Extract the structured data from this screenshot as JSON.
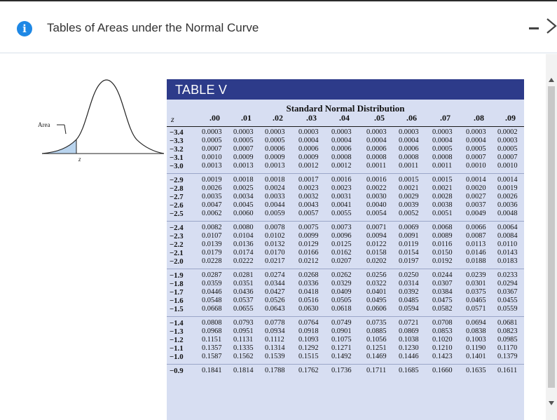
{
  "window": {
    "title": "Tables of Areas under the Normal Curve",
    "icons": {
      "info": "info-icon",
      "minimize": "minimize-icon",
      "close": "close-icon"
    }
  },
  "figure": {
    "area_label": "Area",
    "z_axis_label": "z"
  },
  "table": {
    "heading": "TABLE V",
    "subtitle": "Standard Normal Distribution",
    "z_header": "z",
    "columns": [
      ".00",
      ".01",
      ".02",
      ".03",
      ".04",
      ".05",
      ".06",
      ".07",
      ".08",
      ".09"
    ],
    "groups": [
      [
        {
          "z": "−3.4",
          "values": [
            "0.0003",
            "0.0003",
            "0.0003",
            "0.0003",
            "0.0003",
            "0.0003",
            "0.0003",
            "0.0003",
            "0.0003",
            "0.0002"
          ]
        },
        {
          "z": "−3.3",
          "values": [
            "0.0005",
            "0.0005",
            "0.0005",
            "0.0004",
            "0.0004",
            "0.0004",
            "0.0004",
            "0.0004",
            "0.0004",
            "0.0003"
          ]
        },
        {
          "z": "−3.2",
          "values": [
            "0.0007",
            "0.0007",
            "0.0006",
            "0.0006",
            "0.0006",
            "0.0006",
            "0.0006",
            "0.0005",
            "0.0005",
            "0.0005"
          ]
        },
        {
          "z": "−3.1",
          "values": [
            "0.0010",
            "0.0009",
            "0.0009",
            "0.0009",
            "0.0008",
            "0.0008",
            "0.0008",
            "0.0008",
            "0.0007",
            "0.0007"
          ]
        },
        {
          "z": "−3.0",
          "values": [
            "0.0013",
            "0.0013",
            "0.0013",
            "0.0012",
            "0.0012",
            "0.0011",
            "0.0011",
            "0.0011",
            "0.0010",
            "0.0010"
          ]
        }
      ],
      [
        {
          "z": "−2.9",
          "values": [
            "0.0019",
            "0.0018",
            "0.0018",
            "0.0017",
            "0.0016",
            "0.0016",
            "0.0015",
            "0.0015",
            "0.0014",
            "0.0014"
          ]
        },
        {
          "z": "−2.8",
          "values": [
            "0.0026",
            "0.0025",
            "0.0024",
            "0.0023",
            "0.0023",
            "0.0022",
            "0.0021",
            "0.0021",
            "0.0020",
            "0.0019"
          ]
        },
        {
          "z": "−2.7",
          "values": [
            "0.0035",
            "0.0034",
            "0.0033",
            "0.0032",
            "0.0031",
            "0.0030",
            "0.0029",
            "0.0028",
            "0.0027",
            "0.0026"
          ]
        },
        {
          "z": "−2.6",
          "values": [
            "0.0047",
            "0.0045",
            "0.0044",
            "0.0043",
            "0.0041",
            "0.0040",
            "0.0039",
            "0.0038",
            "0.0037",
            "0.0036"
          ]
        },
        {
          "z": "−2.5",
          "values": [
            "0.0062",
            "0.0060",
            "0.0059",
            "0.0057",
            "0.0055",
            "0.0054",
            "0.0052",
            "0.0051",
            "0.0049",
            "0.0048"
          ]
        }
      ],
      [
        {
          "z": "−2.4",
          "values": [
            "0.0082",
            "0.0080",
            "0.0078",
            "0.0075",
            "0.0073",
            "0.0071",
            "0.0069",
            "0.0068",
            "0.0066",
            "0.0064"
          ]
        },
        {
          "z": "−2.3",
          "values": [
            "0.0107",
            "0.0104",
            "0.0102",
            "0.0099",
            "0.0096",
            "0.0094",
            "0.0091",
            "0.0089",
            "0.0087",
            "0.0084"
          ]
        },
        {
          "z": "−2.2",
          "values": [
            "0.0139",
            "0.0136",
            "0.0132",
            "0.0129",
            "0.0125",
            "0.0122",
            "0.0119",
            "0.0116",
            "0.0113",
            "0.0110"
          ]
        },
        {
          "z": "−2.1",
          "values": [
            "0.0179",
            "0.0174",
            "0.0170",
            "0.0166",
            "0.0162",
            "0.0158",
            "0.0154",
            "0.0150",
            "0.0146",
            "0.0143"
          ]
        },
        {
          "z": "−2.0",
          "values": [
            "0.0228",
            "0.0222",
            "0.0217",
            "0.0212",
            "0.0207",
            "0.0202",
            "0.0197",
            "0.0192",
            "0.0188",
            "0.0183"
          ]
        }
      ],
      [
        {
          "z": "−1.9",
          "values": [
            "0.0287",
            "0.0281",
            "0.0274",
            "0.0268",
            "0.0262",
            "0.0256",
            "0.0250",
            "0.0244",
            "0.0239",
            "0.0233"
          ]
        },
        {
          "z": "−1.8",
          "values": [
            "0.0359",
            "0.0351",
            "0.0344",
            "0.0336",
            "0.0329",
            "0.0322",
            "0.0314",
            "0.0307",
            "0.0301",
            "0.0294"
          ]
        },
        {
          "z": "−1.7",
          "values": [
            "0.0446",
            "0.0436",
            "0.0427",
            "0.0418",
            "0.0409",
            "0.0401",
            "0.0392",
            "0.0384",
            "0.0375",
            "0.0367"
          ]
        },
        {
          "z": "−1.6",
          "values": [
            "0.0548",
            "0.0537",
            "0.0526",
            "0.0516",
            "0.0505",
            "0.0495",
            "0.0485",
            "0.0475",
            "0.0465",
            "0.0455"
          ]
        },
        {
          "z": "−1.5",
          "values": [
            "0.0668",
            "0.0655",
            "0.0643",
            "0.0630",
            "0.0618",
            "0.0606",
            "0.0594",
            "0.0582",
            "0.0571",
            "0.0559"
          ]
        }
      ],
      [
        {
          "z": "−1.4",
          "values": [
            "0.0808",
            "0.0793",
            "0.0778",
            "0.0764",
            "0.0749",
            "0.0735",
            "0.0721",
            "0.0708",
            "0.0694",
            "0.0681"
          ]
        },
        {
          "z": "−1.3",
          "values": [
            "0.0968",
            "0.0951",
            "0.0934",
            "0.0918",
            "0.0901",
            "0.0885",
            "0.0869",
            "0.0853",
            "0.0838",
            "0.0823"
          ]
        },
        {
          "z": "−1.2",
          "values": [
            "0.1151",
            "0.1131",
            "0.1112",
            "0.1093",
            "0.1075",
            "0.1056",
            "0.1038",
            "0.1020",
            "0.1003",
            "0.0985"
          ]
        },
        {
          "z": "−1.1",
          "values": [
            "0.1357",
            "0.1335",
            "0.1314",
            "0.1292",
            "0.1271",
            "0.1251",
            "0.1230",
            "0.1210",
            "0.1190",
            "0.1170"
          ]
        },
        {
          "z": "−1.0",
          "values": [
            "0.1587",
            "0.1562",
            "0.1539",
            "0.1515",
            "0.1492",
            "0.1469",
            "0.1446",
            "0.1423",
            "0.1401",
            "0.1379"
          ]
        }
      ],
      [
        {
          "z": "−0.9",
          "values": [
            "0.1841",
            "0.1814",
            "0.1788",
            "0.1762",
            "0.1736",
            "0.1711",
            "0.1685",
            "0.1660",
            "0.1635",
            "0.1611"
          ]
        }
      ]
    ]
  },
  "colors": {
    "info_blue": "#1e88e5",
    "table_header_bg": "#2d3b8a",
    "table_body_bg": "#d7def2",
    "area_fill": "#b9d4ee"
  }
}
